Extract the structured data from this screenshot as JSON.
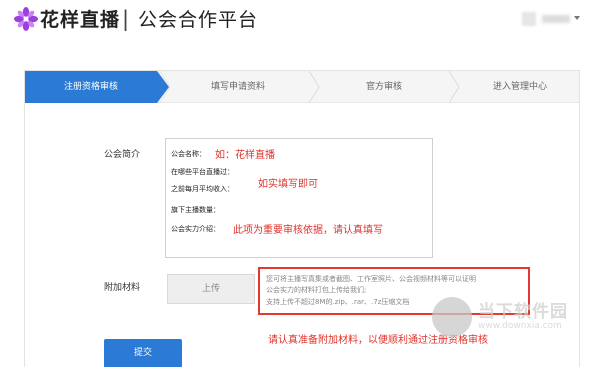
{
  "header": {
    "brand": "花样直播",
    "separator": "|",
    "subtitle": "公会合作平台"
  },
  "steps": [
    {
      "label": "注册资格审核",
      "active": true
    },
    {
      "label": "填写申请资料",
      "active": false
    },
    {
      "label": "官方审核",
      "active": false
    },
    {
      "label": "进入管理中心",
      "active": false
    }
  ],
  "form": {
    "intro_label": "公会简介",
    "intro_lines": [
      "公会名称：",
      "在哪些平台直播过：",
      "之前每月平均收入：",
      "旗下主播数量：",
      "公会实力介绍："
    ],
    "intro_hints": {
      "name_example": "如：花样直播",
      "fill_truthfully": "如实填写即可",
      "important": "此项为重要审核依据，请认真填写"
    },
    "attach_label": "附加材料",
    "upload_label": "上传",
    "attach_lines": [
      "您可将主播写真集或者截图、工作室照片、公会视频材料等可以证明",
      "公会实力的材料打包上传给我们;",
      "支持上传不超过8M的.zip、.rar、.7z压缩文档"
    ],
    "attach_note": "请认真准备附加材料，以便顺利通过注册资格审核",
    "submit_label": "提交"
  },
  "watermark": {
    "title": "当下软件园",
    "url": "www.downxia.com"
  },
  "colors": {
    "accent": "#2b7bd6",
    "highlight": "#e0322b",
    "logo": "#9b3fe0"
  }
}
